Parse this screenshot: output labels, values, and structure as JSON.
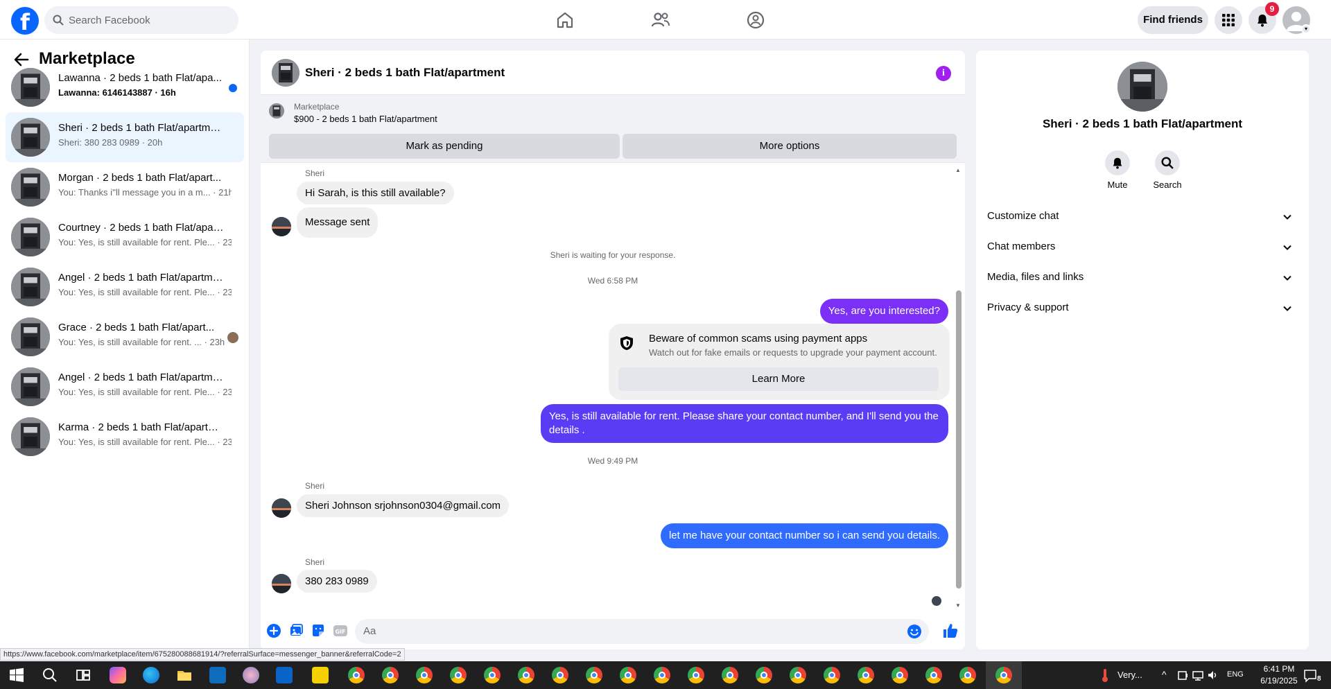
{
  "topbar": {
    "logo": "f",
    "search_placeholder": "Search Facebook",
    "find_friends": "Find friends",
    "notification_count": "9"
  },
  "left": {
    "title": "Marketplace",
    "conversations": [
      {
        "name": "Lawanna · 2 beds 1 bath Flat/apa...",
        "sub": "Lawanna: 6146143887 · 16h",
        "unread": true
      },
      {
        "name": "Sheri · 2 beds 1 bath Flat/apartment",
        "sub": "Sheri: 380 283 0989 · 20h",
        "active": true
      },
      {
        "name": "Morgan · 2 beds 1 bath Flat/apart...",
        "sub": "You: Thanks i''ll message you in a m... · 21h"
      },
      {
        "name": "Courtney · 2 beds 1 bath Flat/apart...",
        "sub": "You: Yes, is still available for rent. Ple... · 23h"
      },
      {
        "name": "Angel · 2 beds 1 bath Flat/apartme...",
        "sub": "You: Yes, is still available for rent. Ple... · 23h"
      },
      {
        "name": "Grace · 2 beds 1 bath Flat/apart...",
        "sub": "You: Yes, is still available for rent. ... · 23h",
        "mini_avatar": true
      },
      {
        "name": "Angel · 2 beds 1 bath Flat/apartme...",
        "sub": "You: Yes, is still available for rent. Ple... · 23h"
      },
      {
        "name": "Karma · 2 beds 1 bath Flat/apartm...",
        "sub": "You: Yes, is still available for rent. Ple... · 23h"
      }
    ]
  },
  "chat": {
    "title": "Sheri · 2 beds 1 bath Flat/apartment",
    "listing_label": "Marketplace",
    "listing_price": "$900 - 2 beds 1 bath Flat/apartment",
    "mark_pending": "Mark as pending",
    "more_options": "More options",
    "sender": "Sheri",
    "msg1": "Hi Sarah, is this still available?",
    "msg2": "Message sent",
    "waiting": "Sheri is waiting for your response.",
    "time1": "Wed 6:58 PM",
    "out1": "Yes, are you interested?",
    "scam_title": "Beware of common scams using payment apps",
    "scam_text": "Watch out for fake emails or requests to upgrade your payment account.",
    "learn_more": "Learn More",
    "out2": "Yes, is still available for rent. Please share your contact number, and I'll send you the details .",
    "time2": "Wed 9:49 PM",
    "msg3": "Sheri Johnson srjohnson0304@gmail.com",
    "out3": "let me have your contact number so i can send you details.",
    "msg4": "380 283 0989",
    "composer_placeholder": "Aa",
    "colors": {
      "out_purple": "#7b2ff7",
      "out_indigo": "#5b3cf5",
      "out_blue": "#2f6bff",
      "accent": "#0866ff"
    }
  },
  "right": {
    "title": "Sheri · 2 beds 1 bath Flat/apartment",
    "mute": "Mute",
    "search": "Search",
    "customize": "Customize chat",
    "members": "Chat members",
    "media": "Media, files and links",
    "privacy": "Privacy & support"
  },
  "status_url": "https://www.facebook.com/marketplace/item/675280088681914/?referralSurface=messenger_banner&referralCode=2",
  "taskbar": {
    "weather": "Very...",
    "lang": "ENG",
    "time": "6:41 PM",
    "date": "6/19/2025",
    "notif": "8"
  }
}
